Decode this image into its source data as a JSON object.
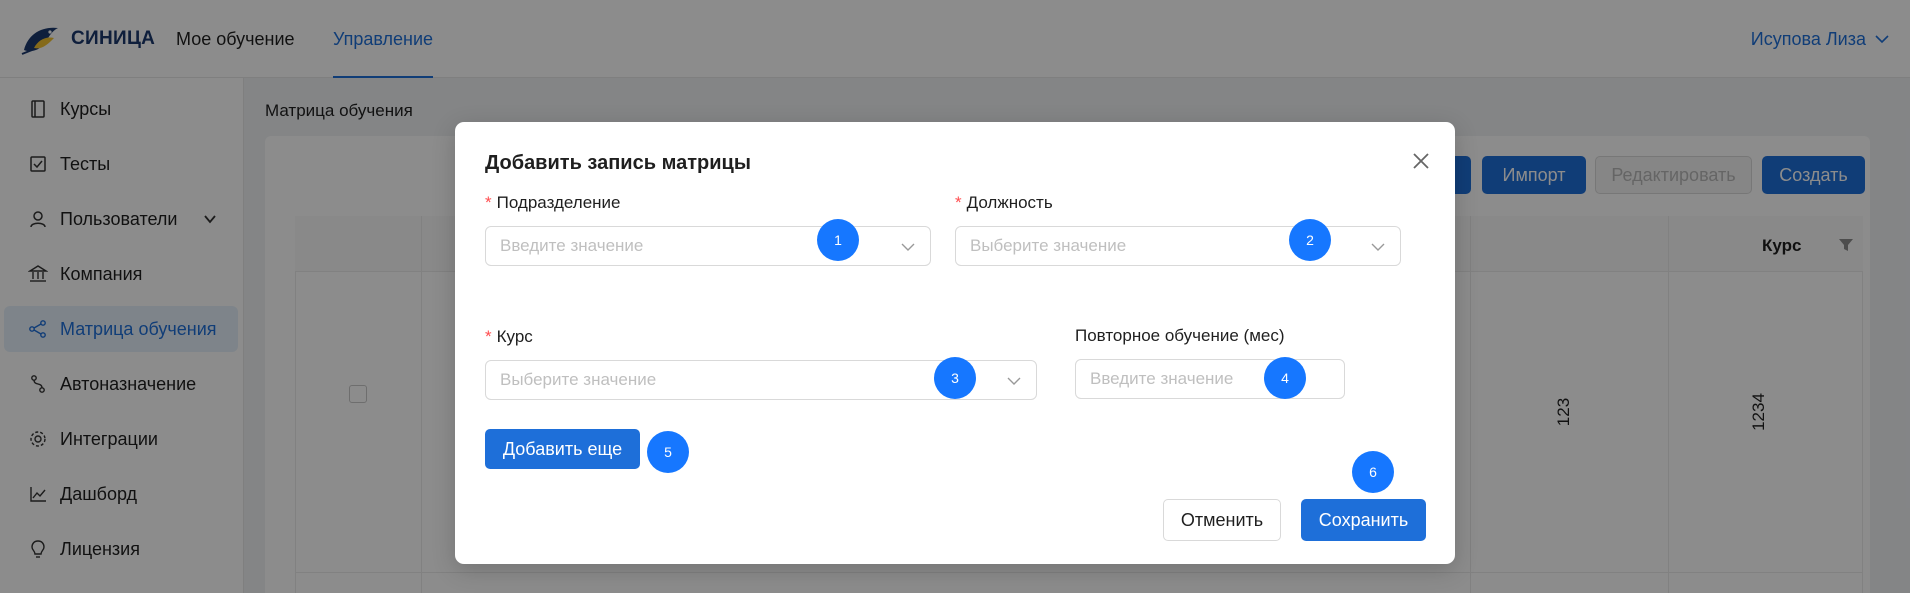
{
  "header": {
    "logo_text": "СИНИЦА",
    "nav": [
      {
        "label": "Мое обучение",
        "active": false
      },
      {
        "label": "Управление",
        "active": true
      }
    ],
    "user_name": "Исупова Лиза"
  },
  "sidebar": {
    "items": [
      {
        "label": "Курсы",
        "icon": "book-icon"
      },
      {
        "label": "Тесты",
        "icon": "checkbox-icon"
      },
      {
        "label": "Пользователи",
        "icon": "user-icon",
        "expandable": true
      },
      {
        "label": "Компания",
        "icon": "bank-icon"
      },
      {
        "label": "Матрица обучения",
        "icon": "share-icon",
        "active": true
      },
      {
        "label": "Автоназначение",
        "icon": "route-icon"
      },
      {
        "label": "Интеграции",
        "icon": "gear-icon"
      },
      {
        "label": "Дашборд",
        "icon": "line-chart-icon"
      },
      {
        "label": "Лицензия",
        "icon": "bulb-icon"
      }
    ]
  },
  "content": {
    "page_title": "Матрица обучения",
    "toolbar": {
      "import_label": "Импорт",
      "edit_label": "Редактировать",
      "create_label": "Создать"
    },
    "table": {
      "course_header": "Курс",
      "row_values": [
        "123",
        "1234"
      ]
    }
  },
  "modal": {
    "title": "Добавить запись матрицы",
    "required_mark": "*",
    "fields": {
      "division": {
        "label": "Подразделение",
        "placeholder": "Введите значение"
      },
      "position": {
        "label": "Должность",
        "placeholder": "Выберите значение"
      },
      "course": {
        "label": "Курс",
        "placeholder": "Выберите значение"
      },
      "retraining": {
        "label": "Повторное обучение (мес)",
        "placeholder": "Введите значение"
      }
    },
    "add_more_label": "Добавить еще",
    "cancel_label": "Отменить",
    "save_label": "Сохранить"
  },
  "markers": [
    "1",
    "2",
    "3",
    "4",
    "5",
    "6"
  ],
  "colors": {
    "primary": "#1e6fd9",
    "marker": "#1677ff",
    "required": "#ff4d4f"
  }
}
